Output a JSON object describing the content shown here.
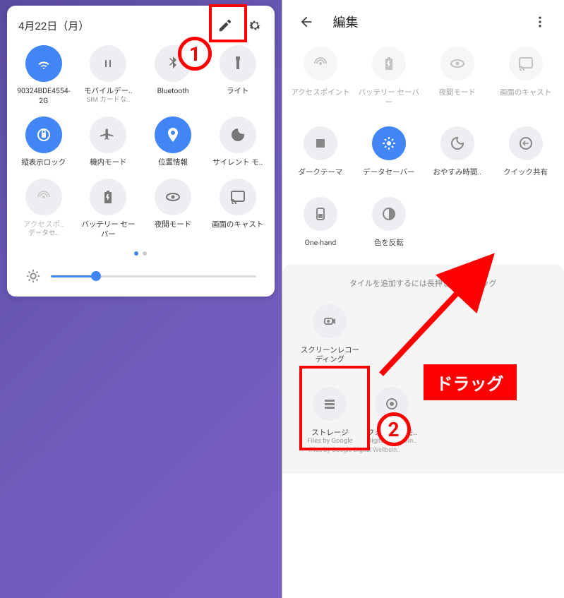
{
  "left": {
    "date": "4月22日（月）",
    "tiles": [
      {
        "label": "90324BDE4554-2G",
        "sub": "",
        "icon": "wifi",
        "active": true
      },
      {
        "label": "モバイルデー..",
        "sub": "SIM カードな..",
        "icon": "mobile",
        "active": false
      },
      {
        "label": "Bluetooth",
        "sub": "",
        "icon": "bluetooth",
        "active": false
      },
      {
        "label": "ライト",
        "sub": "",
        "icon": "flashlight",
        "active": false
      },
      {
        "label": "縦表示ロック",
        "sub": "",
        "icon": "rotate-lock",
        "active": true
      },
      {
        "label": "機内モード",
        "sub": "",
        "icon": "airplane",
        "active": false
      },
      {
        "label": "位置情報",
        "sub": "",
        "icon": "location",
        "active": true
      },
      {
        "label": "サイレント モ..",
        "sub": "",
        "icon": "moon",
        "active": false
      },
      {
        "label": "アクセスポ..",
        "sub": "データセ..",
        "icon": "hotspot",
        "active": false,
        "dim": true
      },
      {
        "label": "バッテリー セーバー",
        "sub": "",
        "icon": "battery",
        "active": false
      },
      {
        "label": "夜間モード",
        "sub": "",
        "icon": "eye",
        "active": false
      },
      {
        "label": "画面のキャスト",
        "sub": "",
        "icon": "cast",
        "active": false
      }
    ],
    "brightness_pct": 22
  },
  "right": {
    "title": "編集",
    "row1": [
      {
        "label": "アクセスポイント",
        "icon": "hotspot"
      },
      {
        "label": "バッテリー セーバー",
        "icon": "battery"
      },
      {
        "label": "夜間モード",
        "icon": "eye"
      },
      {
        "label": "画面のキャスト",
        "icon": "cast"
      }
    ],
    "row2": [
      {
        "label": "ダークテーマ",
        "icon": "dark"
      },
      {
        "label": "データセーバー",
        "icon": "data-saver",
        "active": true
      },
      {
        "label": "おやすみ時間..",
        "icon": "bedtime"
      },
      {
        "label": "クイック共有",
        "icon": "share"
      }
    ],
    "row3": [
      {
        "label": "One-hand",
        "icon": "one-hand"
      },
      {
        "label": "色を反転",
        "icon": "invert"
      }
    ],
    "divider_text": "タイルを追加するには長押ししてドラッグ",
    "available": [
      {
        "label": "スクリーンレコーディング",
        "icon": "record"
      }
    ],
    "available2": [
      {
        "label": "ストレージ",
        "sub": "Files by Google",
        "icon": "storage"
      },
      {
        "label": "フォーカス モ..",
        "sub": "Digital Wellbein..",
        "icon": "focus"
      }
    ]
  },
  "anno": {
    "step1": "1",
    "step2": "2",
    "drag_label": "ドラッグ"
  }
}
